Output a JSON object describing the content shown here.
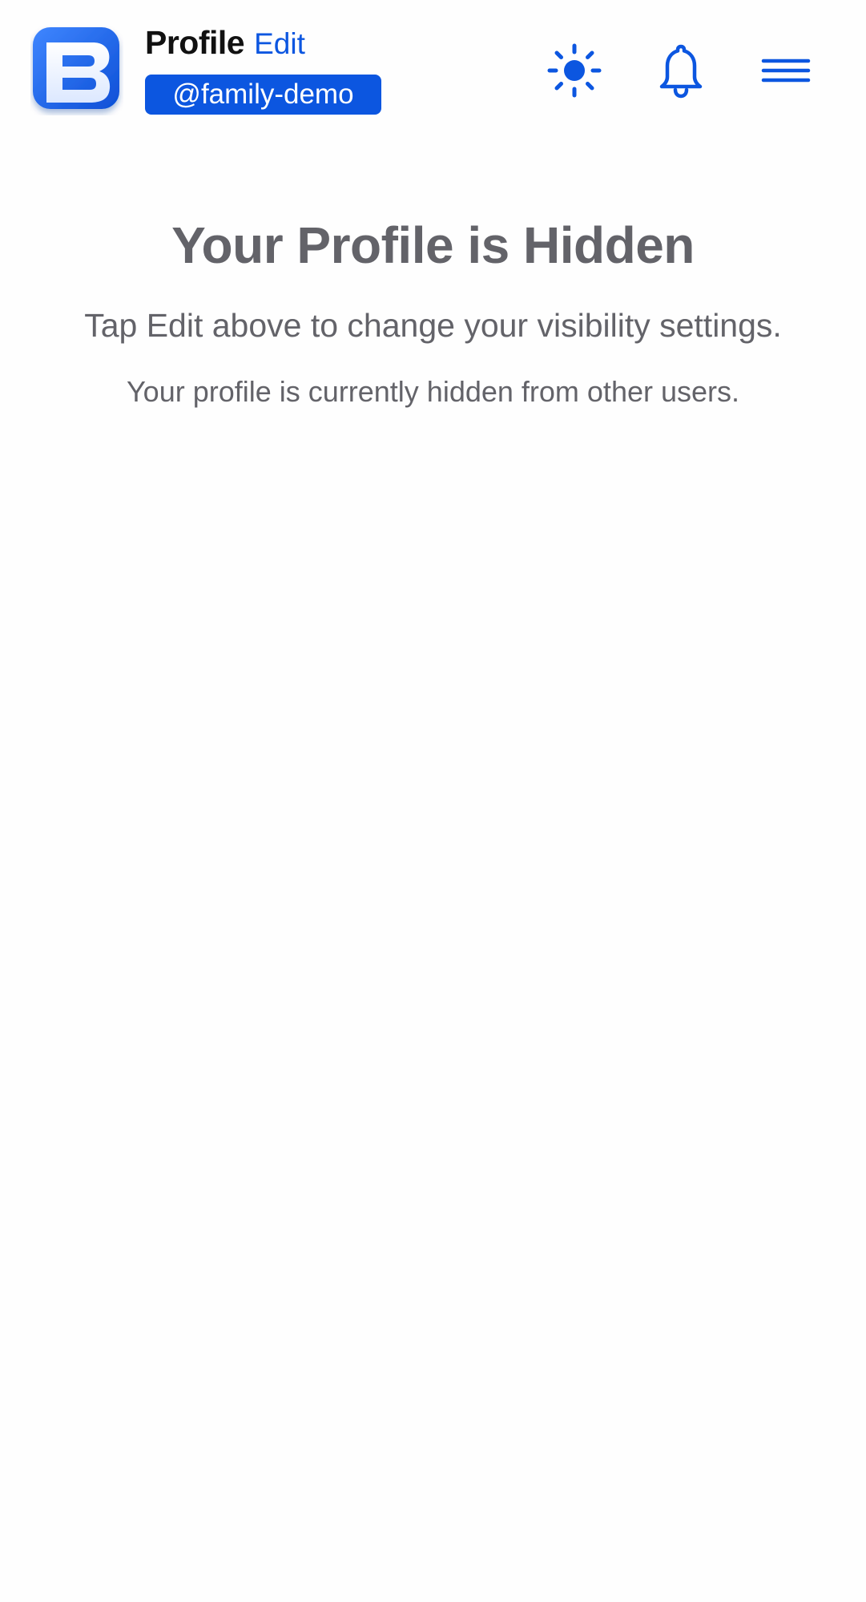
{
  "header": {
    "title": "Profile",
    "edit_label": "Edit",
    "username": "@family-demo",
    "logo_letter": "B"
  },
  "icons": {
    "theme": "sun-icon",
    "notifications": "bell-icon",
    "menu": "hamburger-menu-icon"
  },
  "main": {
    "heading": "Your Profile is Hidden",
    "instruction": "Tap Edit above to change your visibility settings.",
    "status": "Your profile is currently hidden from other users."
  },
  "colors": {
    "accent": "#0c56e0",
    "text_muted": "#636369",
    "title_text": "#111111",
    "background": "#fefefe"
  }
}
